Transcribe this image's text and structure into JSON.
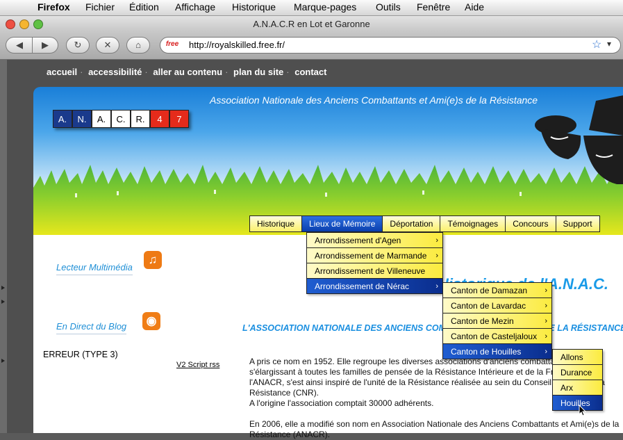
{
  "menubar": {
    "apple": "",
    "items": [
      "Firefox",
      "Fichier",
      "Édition",
      "Affichage",
      "Historique",
      "Marque-pages",
      "Outils",
      "Fenêtre",
      "Aide"
    ]
  },
  "window": {
    "title": "A.N.A.C.R en Lot et Garonne"
  },
  "toolbar": {
    "url": "http://royalskilled.free.fr/",
    "favicon_text": "free",
    "back": "◀",
    "forward": "▶",
    "reload": "↻",
    "stop": "✕",
    "home": "⌂",
    "star": "☆",
    "dropdown": "▾"
  },
  "topnav": [
    "accueil",
    "accessibilité",
    "aller au contenu",
    "plan du site",
    "contact"
  ],
  "banner": {
    "tagline": "Association Nationale des Anciens Combattants et Ami(e)s de la Résistance"
  },
  "logo": [
    {
      "t": "A.",
      "c": "blue"
    },
    {
      "t": "N.",
      "c": "blue"
    },
    {
      "t": "A.",
      "c": "white"
    },
    {
      "t": "C.",
      "c": "white"
    },
    {
      "t": "R.",
      "c": "white"
    },
    {
      "t": "4",
      "c": "red"
    },
    {
      "t": "7",
      "c": "red"
    }
  ],
  "mainnav": [
    "Historique",
    "Lieux de Mémoire",
    "Déportation",
    "Témoignages",
    "Concours",
    "Support"
  ],
  "menu1": [
    {
      "label": "Arrondissement d'Agen",
      "arrow": true
    },
    {
      "label": "Arrondissement de Marmande",
      "arrow": true
    },
    {
      "label": "Arrondissement de Villeneuve",
      "arrow": false
    },
    {
      "label": "Arrondissement de Nérac",
      "arrow": true
    }
  ],
  "menu2": [
    {
      "label": "Canton de Damazan",
      "arrow": true
    },
    {
      "label": "Canton de Lavardac",
      "arrow": true
    },
    {
      "label": "Canton de Mezin",
      "arrow": true
    },
    {
      "label": "Canton de Casteljaloux",
      "arrow": true
    },
    {
      "label": "Canton de Houilles",
      "arrow": true
    }
  ],
  "menu3": [
    "Allons",
    "Durance",
    "Arx",
    "Houilles"
  ],
  "sidebar": {
    "multimedia": "Lecteur Multimédia",
    "blog": "En Direct du Blog",
    "error": "ERREUR (TYPE 3)",
    "v2": "V2 Script rss"
  },
  "main": {
    "heading": "Historique de l'A.N.A.C.",
    "subhead": "L'ASSOCIATION NATIONALE DES ANCIENS COMBATTANTS ET AMI(E)S DE LA RÉSISTANCE  ANAC",
    "paragraphs": [
      "A pris ce nom en 1952. Elle regroupe les diverses associations d'anciens combattants, et s'élargissant à toutes les familles de pensée de la Résistance Intérieure et de la France Libre, l'ANACR, s'est ainsi inspiré de l'unité de la Résistance réalisée au sein du Conseil National de la Résistance (CNR).",
      "A l'origine l'association comptait 30000 adhérents.",
      "",
      "En 2006, elle a modifié son nom en Association Nationale des Anciens Combattants et Ami(e)s de la Résistance (ANACR)."
    ]
  }
}
